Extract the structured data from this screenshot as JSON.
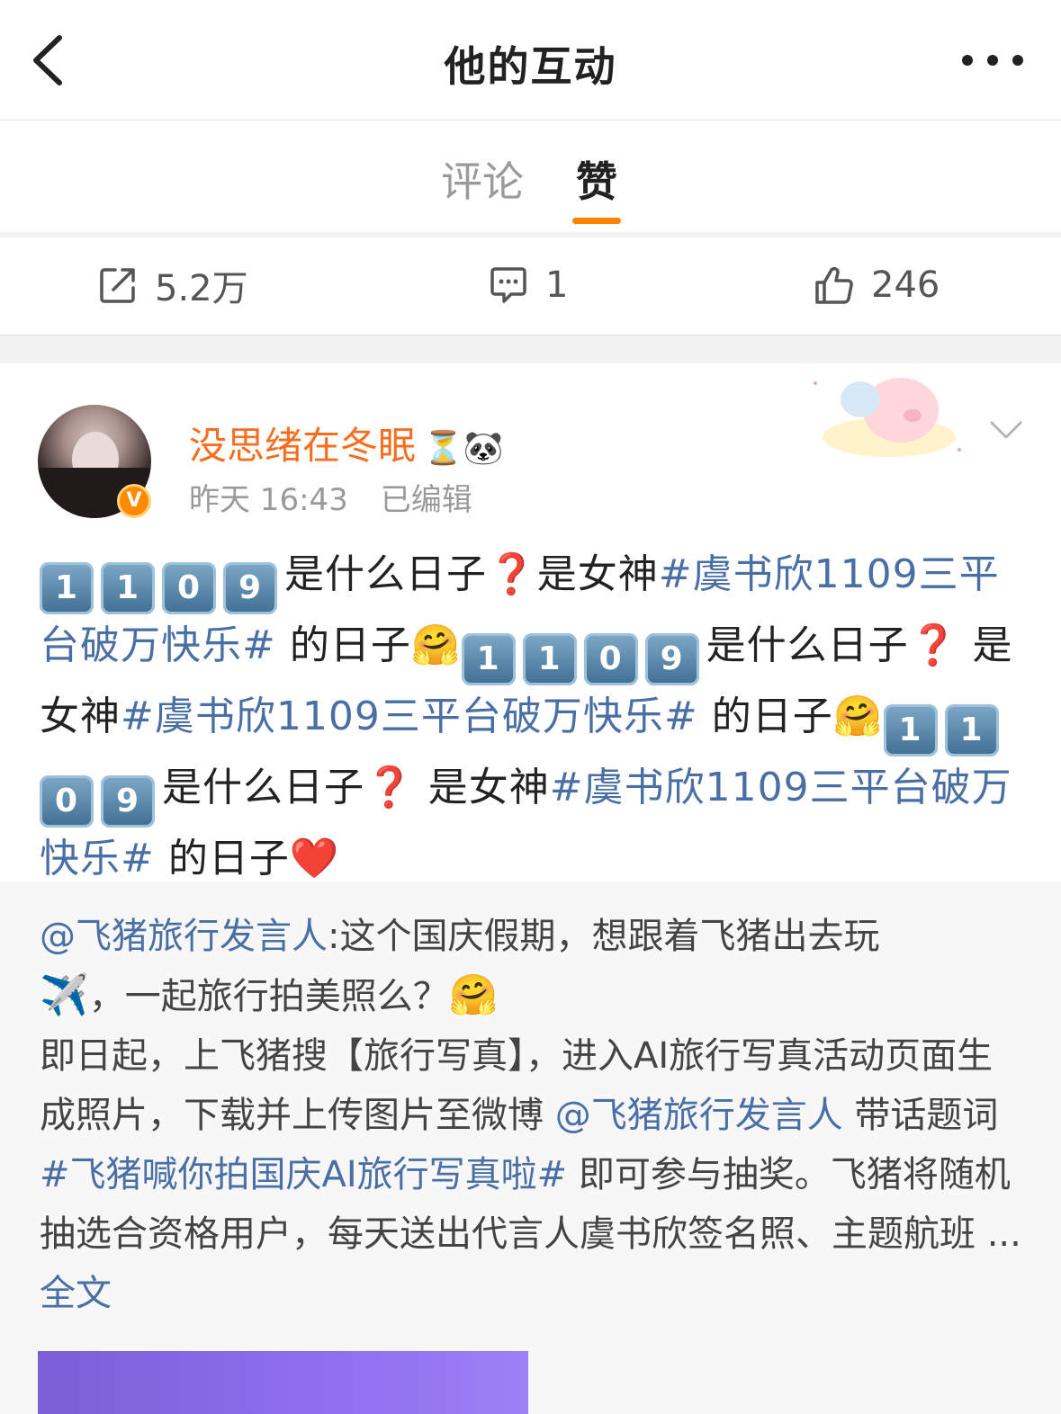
{
  "navbar": {
    "title": "他的互动"
  },
  "tabs": [
    {
      "label": "评论",
      "active": false
    },
    {
      "label": "赞",
      "active": true
    }
  ],
  "stats": {
    "reposts": "5.2万",
    "comments": "1",
    "likes": "246"
  },
  "post": {
    "username": "没思绪在冬眠",
    "name_emoji": "⏳🐼",
    "time": "昨天 16:43",
    "edited": "已编辑",
    "verified": "V",
    "line1": {
      "keycaps": [
        "1",
        "1",
        "0",
        "9"
      ],
      "text_a": "是什么日子",
      "q": "❓",
      "text_b": "是女神",
      "hashtag": "#虞书欣1109三平台破万快乐#",
      "text_c": " 的日子",
      "emoji": "🤗"
    },
    "line2": {
      "keycaps": [
        "1",
        "1",
        "0",
        "9"
      ],
      "text_a": "是什么日子",
      "q": "❓",
      "text_b": " 是女神",
      "hashtag": "#虞书欣1109三平台破万快乐#",
      "text_c": " 的日子",
      "emoji": "🤗"
    },
    "line3": {
      "keycaps": [
        "1",
        "1",
        "0",
        "9"
      ],
      "text_a": "是什么日子",
      "q": "❓",
      "text_b": " 是女神",
      "hashtag": "#虞书欣1109三平台破万快乐#",
      "text_c": " 的日子",
      "emoji": "❤️"
    }
  },
  "quote": {
    "mention1": "@飞猪旅行发言人",
    "text1": ":这个国庆假期，想跟着飞猪出去玩",
    "emoji1": "✈️",
    "text2": "，一起旅行拍美照么？",
    "emoji2": "🤗",
    "text3": "即日起，上飞猪搜【旅行写真】，进入AI旅行写真活动页面生成照片，下载并上传图片至微博 ",
    "mention2": "@飞猪旅行发言人",
    "text4": " 带话题词 ",
    "hashtag": "#飞猪喊你拍国庆AI旅行写真啦#",
    "text5": " 即可参与抽奖。飞猪将随机抽选合资格用户，每天送出代言人虞书欣签名照、主题航班 ... ",
    "more": "全文"
  },
  "colors": {
    "accent": "#ff8200",
    "username": "#f86e21",
    "link": "#4a6fa5"
  },
  "icons": [
    "back-arrow-icon",
    "more-dots-icon",
    "repost-icon",
    "comment-icon",
    "like-icon",
    "chevron-down-icon"
  ]
}
